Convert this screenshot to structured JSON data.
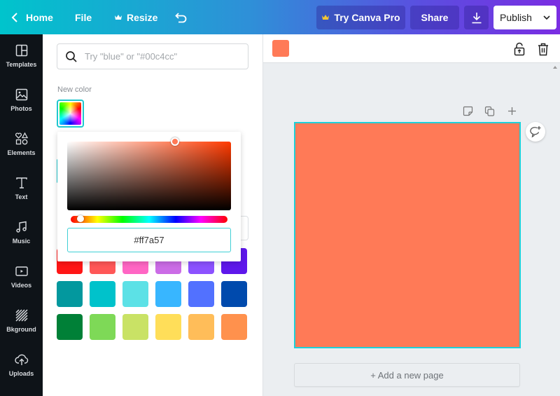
{
  "topbar": {
    "home_label": "Home",
    "file_label": "File",
    "resize_label": "Resize",
    "try_pro_label": "Try Canva Pro",
    "share_label": "Share",
    "publish_label": "Publish"
  },
  "sidebar": {
    "items": [
      {
        "label": "Templates",
        "icon": "templates-icon"
      },
      {
        "label": "Photos",
        "icon": "photos-icon"
      },
      {
        "label": "Elements",
        "icon": "elements-icon"
      },
      {
        "label": "Text",
        "icon": "text-icon"
      },
      {
        "label": "Music",
        "icon": "music-icon"
      },
      {
        "label": "Videos",
        "icon": "videos-icon"
      },
      {
        "label": "Bkground",
        "icon": "background-icon"
      },
      {
        "label": "Uploads",
        "icon": "uploads-icon"
      }
    ]
  },
  "panel": {
    "search_placeholder": "Try \"blue\" or \"#00c4cc\"",
    "new_color_label": "New color",
    "swatches": [
      [
        "#ff1616",
        "#ff5757",
        "#ff66c4",
        "#cb6ce6",
        "#8c52ff",
        "#5e17eb"
      ],
      [
        "#03989e",
        "#00c2cb",
        "#5ce1e6",
        "#38b6ff",
        "#5271ff",
        "#004aad"
      ],
      [
        "#008037",
        "#7ed957",
        "#c9e265",
        "#ffde59",
        "#ffbd59",
        "#ff914d"
      ]
    ]
  },
  "picker": {
    "hex_value": "#ff7a57",
    "hue_fraction": 0.04,
    "saturation": 0.66,
    "value": 1.0
  },
  "canvas": {
    "selected_color": "#ff7a57",
    "page_color": "#ff7a57",
    "add_page_label": "+ Add a new page"
  }
}
